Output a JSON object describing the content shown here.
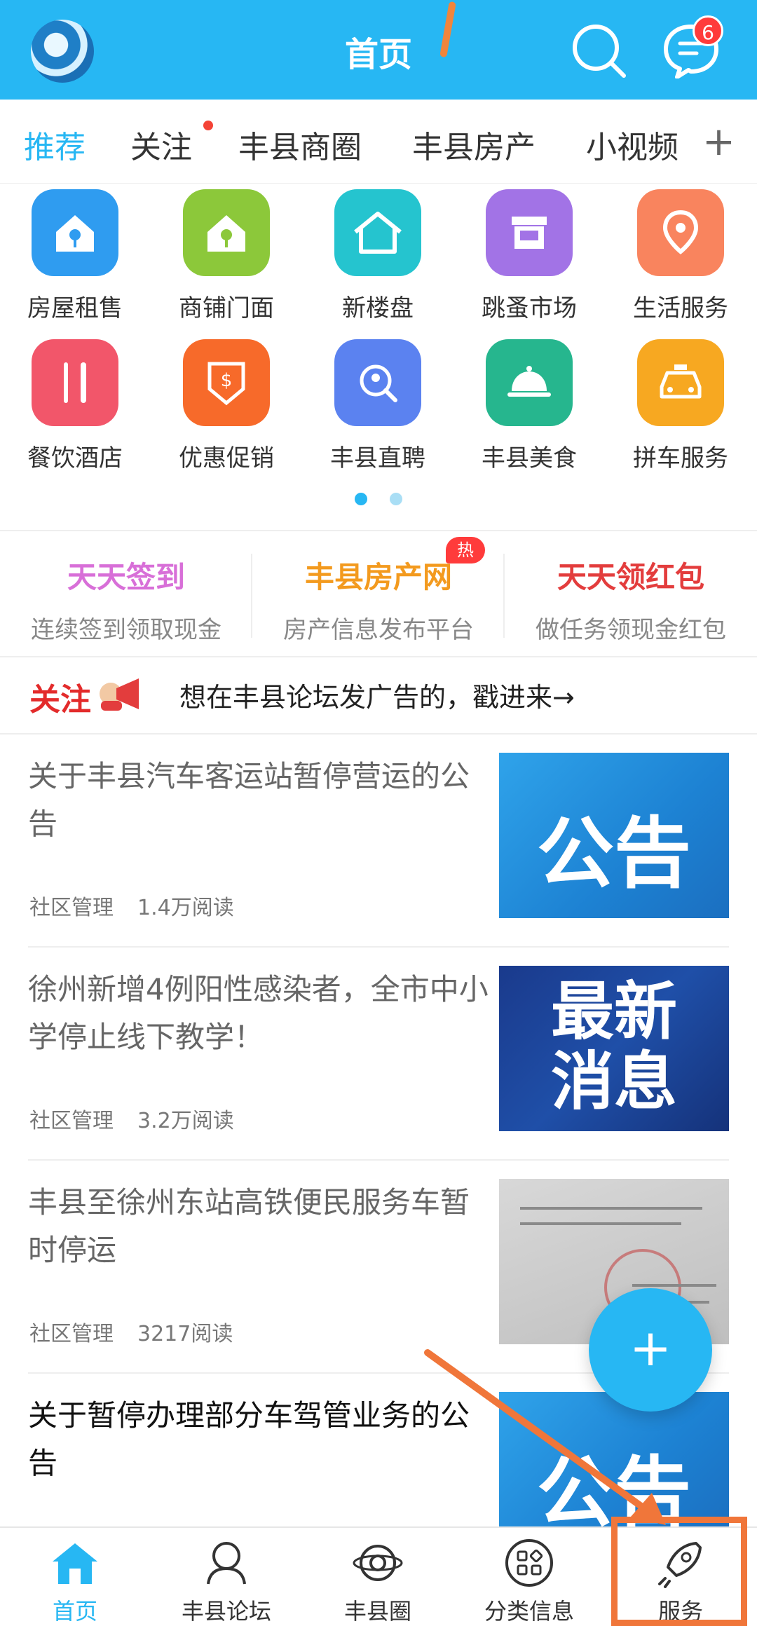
{
  "header": {
    "title": "首页",
    "message_badge": "6",
    "colors": {
      "primary": "#27b7f3",
      "badge": "#ff3b3b",
      "annotation": "#f0763a"
    }
  },
  "tabs": [
    {
      "label": "推荐",
      "active": true
    },
    {
      "label": "关注",
      "has_dot": true
    },
    {
      "label": "丰县商圈"
    },
    {
      "label": "丰县房产"
    },
    {
      "label": "小视频"
    }
  ],
  "tabs_more": "+",
  "grid": [
    {
      "label": "房屋租售",
      "icon": "house-key-icon"
    },
    {
      "label": "商铺门面",
      "icon": "shop-key-icon"
    },
    {
      "label": "新楼盘",
      "icon": "new-building-icon"
    },
    {
      "label": "跳蚤市场",
      "icon": "flea-market-icon"
    },
    {
      "label": "生活服务",
      "icon": "location-pin-icon"
    },
    {
      "label": "餐饮酒店",
      "icon": "fork-knife-icon"
    },
    {
      "label": "优惠促销",
      "icon": "price-tag-icon"
    },
    {
      "label": "丰县直聘",
      "icon": "recruit-search-icon"
    },
    {
      "label": "丰县美食",
      "icon": "food-cloche-icon"
    },
    {
      "label": "拼车服务",
      "icon": "taxi-icon"
    }
  ],
  "features": [
    {
      "title": "天天签到",
      "subtitle": "连续签到领取现金",
      "color": "#d86fd8"
    },
    {
      "title": "丰县房产网",
      "subtitle": "房产信息发布平台",
      "color": "#f39a1e",
      "badge": "热"
    },
    {
      "title": "天天领红包",
      "subtitle": "做任务领现金红包",
      "color": "#e33d3d"
    }
  ],
  "notice": {
    "tag": "关注",
    "text": "想在丰县论坛发广告的，戳进来→"
  },
  "news": [
    {
      "title": "关于丰县汽车客运站暂停营运的公告",
      "source": "社区管理",
      "reads": "1.4万阅读",
      "thumb_text": "公告"
    },
    {
      "title": "徐州新增4例阳性感染者，全市中小学停止线下教学！",
      "source": "社区管理",
      "reads": "3.2万阅读",
      "thumb_text_1": "最新",
      "thumb_text_2": "消息"
    },
    {
      "title": "丰县至徐州东站高铁便民服务车暂时停运",
      "source": "社区管理",
      "reads": "3217阅读"
    },
    {
      "title": "关于暂停办理部分车驾管业务的公告",
      "thumb_text": "公告"
    }
  ],
  "fab_label": "+",
  "bottom_nav": [
    {
      "label": "首页",
      "icon": "home-icon",
      "active": true
    },
    {
      "label": "丰县论坛",
      "icon": "forum-icon"
    },
    {
      "label": "丰县圈",
      "icon": "planet-icon"
    },
    {
      "label": "分类信息",
      "icon": "category-grid-icon"
    },
    {
      "label": "服务",
      "icon": "rocket-icon"
    }
  ]
}
